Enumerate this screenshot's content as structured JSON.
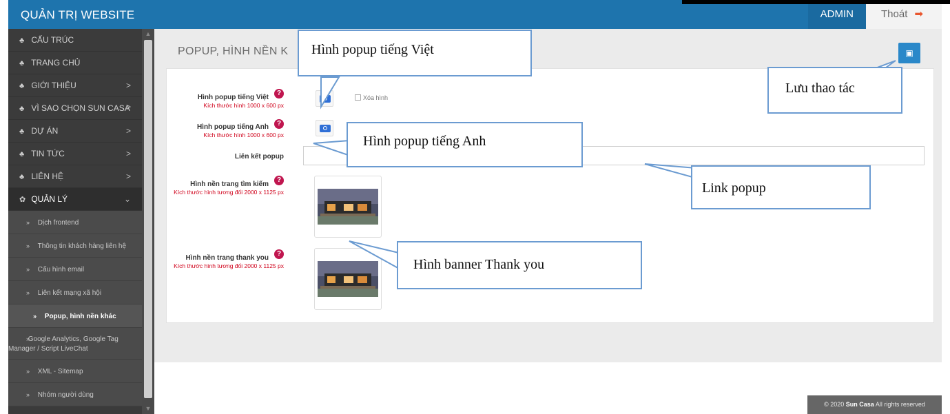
{
  "header": {
    "brand": "QUẢN TRỊ WEBSITE",
    "admin": "ADMIN",
    "logout": "Thoát"
  },
  "sidebar": {
    "items": [
      {
        "label": "CẤU TRÚC",
        "chevron": ""
      },
      {
        "label": "TRANG CHỦ",
        "chevron": ""
      },
      {
        "label": "GIỚI THIỆU",
        "chevron": ">"
      },
      {
        "label": "VÌ SAO CHỌN SUN CASA",
        "chevron": ">"
      },
      {
        "label": "DỰ ÁN",
        "chevron": ">"
      },
      {
        "label": "TIN TỨC",
        "chevron": ">"
      },
      {
        "label": "LIÊN HỆ",
        "chevron": ">"
      },
      {
        "label": "QUẢN LÝ",
        "chevron": "⌄"
      }
    ],
    "subitems": [
      "Dịch frontend",
      "Thông tin khách hàng liên hệ",
      "Cấu hình email",
      "Liên kết mạng xã hội",
      "Popup, hình nền khác",
      "Google Analytics, Google Tag Manager / Script LiveChat",
      "XML - Sitemap",
      "Nhóm người dùng"
    ]
  },
  "page": {
    "title": "POPUP, HÌNH NỀN K",
    "fields": {
      "popup_vi": {
        "label": "Hình popup tiếng Việt",
        "hint": "Kích thước hình 1000 x 600 px",
        "delete": "Xóa hình"
      },
      "popup_en": {
        "label": "Hình popup tiếng Anh",
        "hint": "Kích thước hình 1000 x 600 px"
      },
      "popup_link": {
        "label": "Liên kết popup",
        "value": ""
      },
      "bg_search": {
        "label": "Hình nền trang tìm kiếm",
        "hint": "Kích thước hình tương đối 2000 x 1125 px"
      },
      "bg_thanks": {
        "label": "Hình nền trang thank you",
        "hint": "Kích thước hình tương đối 2000 x 1125 px"
      }
    }
  },
  "footer": {
    "year": "© 2020",
    "brand": "Sun Casa",
    "rights": "All rights reserved"
  },
  "callouts": {
    "popup_vi": "Hình popup tiếng Việt",
    "save": "Lưu thao tác",
    "popup_en": "Hình popup tiếng Anh",
    "link": "Link popup",
    "banner": "Hình banner Thank you"
  },
  "colors": {
    "topbar": "#1e74ad",
    "sidebar": "#3b3b3b",
    "help": "#c0164f",
    "hint": "#d0021b",
    "callout_border": "#6b9bd1"
  }
}
